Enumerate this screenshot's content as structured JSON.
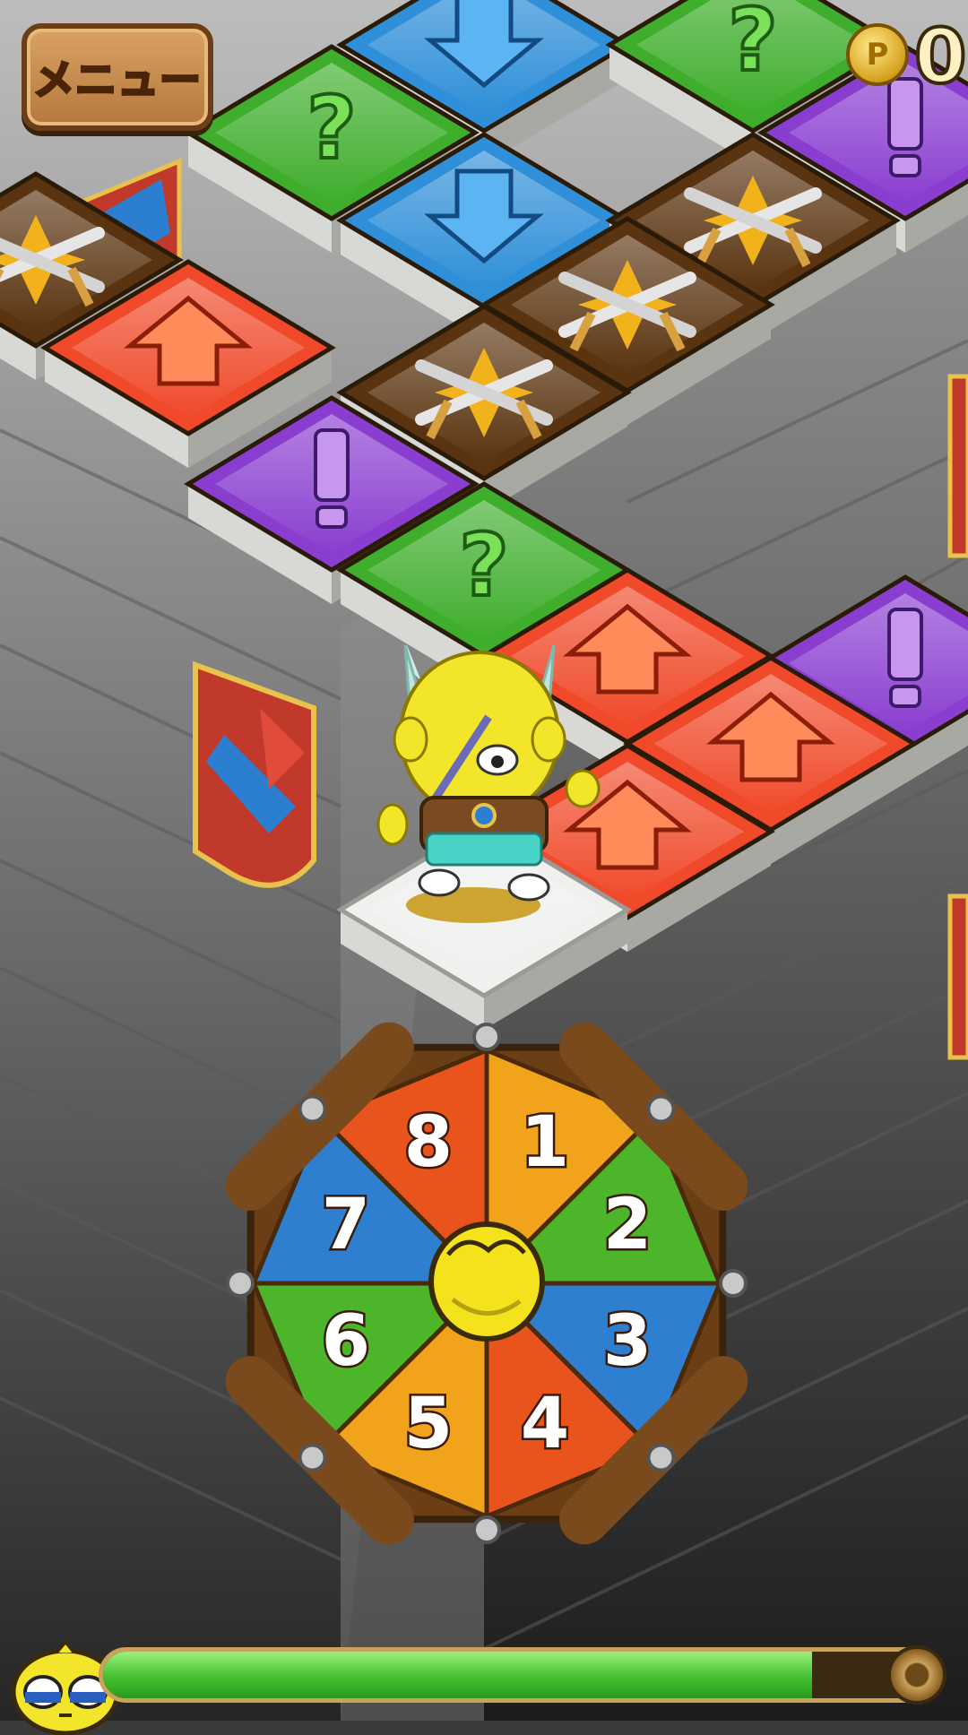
{
  "menu": {
    "label": "メニュー"
  },
  "coins": {
    "count": "0"
  },
  "hp": {
    "fill_fraction": 0.86
  },
  "spinner": {
    "numbers": [
      "1",
      "2",
      "3",
      "4",
      "5",
      "6",
      "7",
      "8"
    ]
  },
  "colors": {
    "green_tile": "#3fae2c",
    "blue_tile": "#2f8fd8",
    "red_tile": "#f04a2a",
    "purple_tile": "#8a3ed0",
    "brown_tile": "#5a3410",
    "white_tile": "#f0f0ee",
    "wood": "#6b3e16"
  },
  "icons": [
    "question-icon",
    "down-arrow-icon",
    "up-arrow-icon",
    "exclamation-icon",
    "crossed-swords-icon",
    "coin-icon"
  ]
}
